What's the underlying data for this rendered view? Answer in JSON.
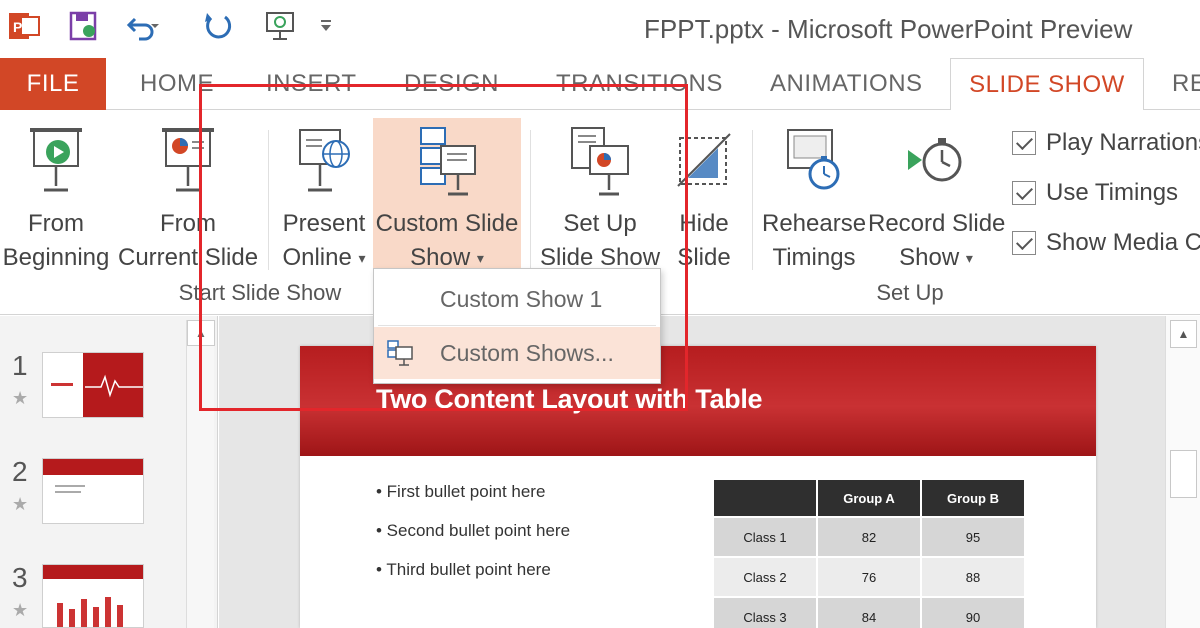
{
  "window": {
    "title": "FPPT.pptx - Microsoft PowerPoint Preview"
  },
  "quick_access": [
    {
      "name": "powerpoint-logo-icon"
    },
    {
      "name": "save-icon"
    },
    {
      "name": "undo-icon"
    },
    {
      "name": "redo-icon"
    },
    {
      "name": "start-slideshow-icon"
    },
    {
      "name": "customize-qat-icon"
    }
  ],
  "tabs": [
    {
      "label": "FILE"
    },
    {
      "label": "HOME"
    },
    {
      "label": "INSERT"
    },
    {
      "label": "DESIGN"
    },
    {
      "label": "TRANSITIONS"
    },
    {
      "label": "ANIMATIONS"
    },
    {
      "label": "SLIDE SHOW"
    },
    {
      "label": "RE"
    }
  ],
  "ribbon": {
    "from_beginning": {
      "line1": "From",
      "line2": "Beginning"
    },
    "from_current": {
      "line1": "From",
      "line2": "Current Slide"
    },
    "present_online": {
      "line1": "Present",
      "line2": "Online"
    },
    "custom_slide_show": {
      "line1": "Custom Slide",
      "line2": "Show"
    },
    "set_up_slide_show": {
      "line1": "Set Up",
      "line2": "Slide Show"
    },
    "hide_slide": {
      "line1": "Hide",
      "line2": "Slide"
    },
    "rehearse_timings": {
      "line1": "Rehearse",
      "line2": "Timings"
    },
    "record_slide_show": {
      "line1": "Record Slide",
      "line2": "Show"
    },
    "groups": {
      "start_slide_show": "Start Slide Show",
      "set_up": "Set Up"
    },
    "checkboxes": [
      {
        "label": "Play Narrations",
        "checked": true
      },
      {
        "label": "Use Timings",
        "checked": true
      },
      {
        "label": "Show Media C",
        "checked": true
      }
    ]
  },
  "dropdown": {
    "items": [
      {
        "label": "Custom Show 1"
      },
      {
        "label": "Custom Shows..."
      }
    ]
  },
  "thumbnails": [
    {
      "num": "1"
    },
    {
      "num": "2"
    },
    {
      "num": "3"
    }
  ],
  "slide": {
    "title": "Two Content Layout with Table",
    "bullets": [
      "• First bullet point here",
      "• Second bullet point here",
      "• Third bullet point here"
    ],
    "table": {
      "headers": [
        "",
        "Group A",
        "Group B"
      ],
      "rows": [
        [
          "Class 1",
          "82",
          "95"
        ],
        [
          "Class 2",
          "76",
          "88"
        ],
        [
          "Class 3",
          "84",
          "90"
        ]
      ]
    }
  },
  "colors": {
    "accent": "#d24726",
    "highlight": "#f9d9c8",
    "annotation": "#e3262b",
    "slide_header": "#c93133"
  }
}
